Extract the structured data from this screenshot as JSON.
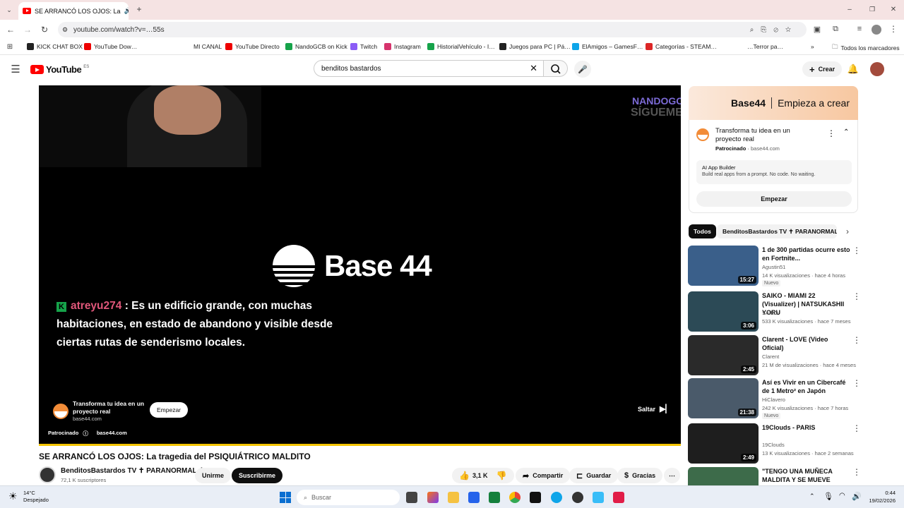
{
  "browser": {
    "tab_title": "SE ARRANCÓ LOS OJOS: La",
    "url": "youtube.com/watch?v=…55s",
    "bookmarks": [
      "KICK CHAT BOX",
      "YouTube Dow…",
      "MI CANAL",
      "YouTube Directo",
      "NandoGCB on Kick",
      "Twitch",
      "Instagram",
      "HistorialVehículo - I…",
      "Juegos para PC | Pá…",
      "ElAmigos – GamesF…",
      "Categorías - STEAM…",
      "…Terror pa…"
    ],
    "all_bookmarks": "Todos los marcadores"
  },
  "header": {
    "logo": "YouTube",
    "region": "ES",
    "search_value": "benditos bastardos",
    "create_label": "Crear"
  },
  "player": {
    "chat_user": "atreyu274",
    "chat_text": " : Es un edificio grande, con muchas habitaciones, en estado de abandono y visible desde ciertas rutas de senderismo locales.",
    "overlay_name": "NANDOGCB",
    "overlay_follow": "SÍGUEME",
    "ad_brand": "Base 44",
    "ad_card_title": "Transforma tu idea en un proyecto real",
    "ad_card_domain": "base44.com",
    "ad_card_button": "Empezar",
    "skip_label": "Saltar",
    "sponsored": "Patrocinado",
    "sponsored_domain": "base44.com",
    "progress_pct": 100
  },
  "video": {
    "title": "SE ARRANCÓ LOS OJOS: La tragedia del PSIQUIÁTRICO MALDITO",
    "channel": "BenditosBastardos TV ✝ PARANORMAL ✝",
    "subscribers": "72,1 K suscriptores",
    "join_label": "Unirme",
    "subscribe_label": "Suscribirme",
    "likes": "3,1 K",
    "share_label": "Compartir",
    "save_label": "Guardar",
    "thanks_label": "Gracias"
  },
  "sidebar_ad": {
    "banner_brand": "Base44",
    "banner_tagline": "Empieza a crear",
    "title": "Transforma tu idea en un proyecto real",
    "sponsored": "Patrocinado",
    "domain": "base44.com",
    "feature_title": "AI App Builder",
    "feature_desc": "Build real apps from a prompt. No code. No waiting.",
    "button": "Empezar"
  },
  "filters": [
    "Todos",
    "BenditosBastardos TV ✝ PARANORMAL ✝"
  ],
  "recommendations": [
    {
      "title": "1 de 300 partidas ocurre esto en Fortnite...",
      "channel": "Agustin51",
      "meta": "14 K visualizaciones · hace 4 horas",
      "badge": "Nuevo",
      "duration": "15:27",
      "thumb": "#3a5f8a"
    },
    {
      "title": "SAIKO - MIAMI 22 (Visualizer) | NATSUKASHII YORU",
      "channel": "SAIKO",
      "meta": "533 K visualizaciones · hace 7 meses",
      "badge": "",
      "duration": "3:06",
      "thumb": "#2c4a56"
    },
    {
      "title": "Clarent - LOVE (Video Oficial)",
      "channel": "Clarent",
      "meta": "21 M de visualizaciones · hace 4 meses",
      "badge": "",
      "duration": "2:45",
      "thumb": "#2a2a2a"
    },
    {
      "title": "Así es Vivir en un Cibercafé de 1 Metro² en Japón",
      "channel": "HiClavero",
      "meta": "242 K visualizaciones · hace 7 horas",
      "badge": "Nuevo",
      "duration": "21:38",
      "thumb": "#4a5a6a"
    },
    {
      "title": "19Clouds - PARIS",
      "channel": "19Clouds",
      "meta": "13 K visualizaciones · hace 2 semanas",
      "badge": "",
      "duration": "2:49",
      "thumb": "#1e1e1e"
    },
    {
      "title": "\"TENGO UNA MUÑECA MALDITA Y SE MUEVE SOLA\"...",
      "channel": "",
      "meta": "",
      "badge": "",
      "duration": "",
      "thumb": "#3d6b4a"
    }
  ],
  "taskbar": {
    "temperature": "14°C",
    "weather": "Despejado",
    "search_placeholder": "Buscar",
    "time": "0:44",
    "date": "19/02/2026"
  }
}
